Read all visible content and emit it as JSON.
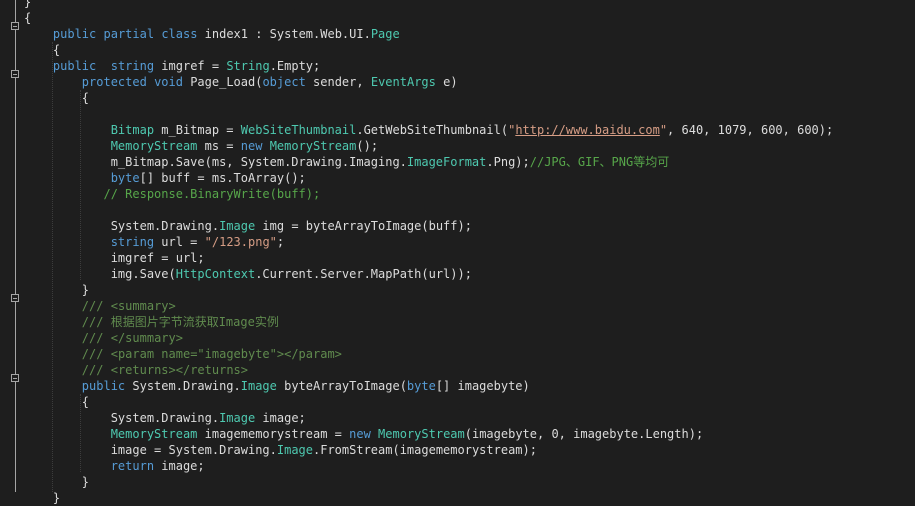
{
  "code": {
    "l00": {
      "a": "}"
    },
    "l01": {
      "a": "{"
    },
    "l02": {
      "a": "    ",
      "b": "public",
      "c": " ",
      "d": "partial",
      "e": " ",
      "f": "class",
      "g": " index1 : System.Web.UI.",
      "h": "Page"
    },
    "l03": {
      "a": "    {"
    },
    "l04": {
      "a": "    ",
      "b": "public",
      "c": "  ",
      "d": "string",
      "e": " imgref = ",
      "f": "String",
      "g": ".Empty;"
    },
    "l05": {
      "a": "        ",
      "b": "protected",
      "c": " ",
      "d": "void",
      "e": " Page_Load(",
      "f": "object",
      "g": " sender, ",
      "h": "EventArgs",
      "i": " e)"
    },
    "l06": {
      "a": "        {"
    },
    "l08": {
      "a": "            ",
      "b": "Bitmap",
      "c": " m_Bitmap = ",
      "d": "WebSiteThumbnail",
      "e": ".GetWebSiteThumbnail(",
      "f": "\"",
      "g": "http://www.baidu.com",
      "h": "\"",
      "i": ", 640, 1079, 600, 600);"
    },
    "l09": {
      "a": "            ",
      "b": "MemoryStream",
      "c": " ms = ",
      "d": "new",
      "e": " ",
      "f": "MemoryStream",
      "g": "();"
    },
    "l10": {
      "a": "            m_Bitmap.Save(ms, System.Drawing.Imaging.",
      "b": "ImageFormat",
      "c": ".Png);",
      "d": "//JPG、GIF、PNG等均可"
    },
    "l11": {
      "a": "            ",
      "b": "byte",
      "c": "[] buff = ms.ToArray();"
    },
    "l12": {
      "a": "           ",
      "b": "// Response.BinaryWrite(buff);"
    },
    "l14": {
      "a": "            System.Drawing.",
      "b": "Image",
      "c": " img = byteArrayToImage(buff);"
    },
    "l15": {
      "a": "            ",
      "b": "string",
      "c": " url = ",
      "d": "\"/123.png\"",
      "e": ";"
    },
    "l16": {
      "a": "            imgref = url;"
    },
    "l17": {
      "a": "            img.Save(",
      "b": "HttpContext",
      "c": ".Current.Server.MapPath(url));"
    },
    "l18": {
      "a": "        }"
    },
    "l19": {
      "a": "        ",
      "b": "///",
      "c": " ",
      "d": "<summary>"
    },
    "l20": {
      "a": "        ",
      "b": "///",
      "c": " 根据图片字节流获取Image实例"
    },
    "l21": {
      "a": "        ",
      "b": "///",
      "c": " ",
      "d": "</summary>"
    },
    "l22": {
      "a": "        ",
      "b": "///",
      "c": " ",
      "d": "<param name=\"imagebyte\"></param>"
    },
    "l23": {
      "a": "        ",
      "b": "///",
      "c": " ",
      "d": "<returns></returns>"
    },
    "l24": {
      "a": "        ",
      "b": "public",
      "c": " System.Drawing.",
      "d": "Image",
      "e": " byteArrayToImage(",
      "f": "byte",
      "g": "[] imagebyte)"
    },
    "l25": {
      "a": "        {"
    },
    "l26": {
      "a": "            System.Drawing.",
      "b": "Image",
      "c": " image;"
    },
    "l27": {
      "a": "            ",
      "b": "MemoryStream",
      "c": " imagememorystream = ",
      "d": "new",
      "e": " ",
      "f": "MemoryStream",
      "g": "(imagebyte, 0, imagebyte.Length);"
    },
    "l28": {
      "a": "            image = System.Drawing.",
      "b": "Image",
      "c": ".FromStream(imagememorystream);"
    },
    "l29": {
      "a": "            ",
      "b": "return",
      "c": " image;"
    },
    "l30": {
      "a": "        }"
    },
    "l31": {
      "a": "    }"
    }
  }
}
